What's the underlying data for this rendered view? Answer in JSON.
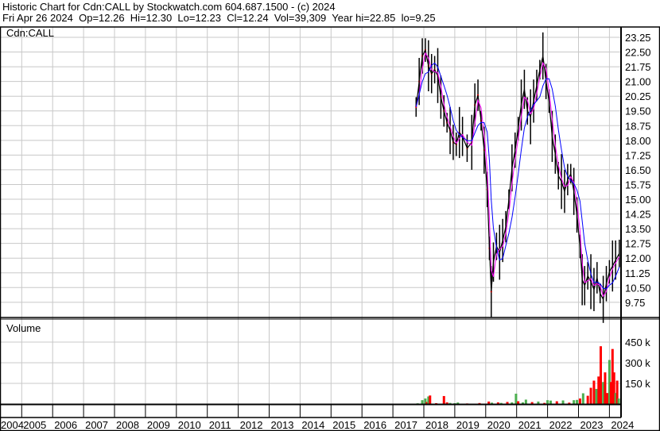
{
  "header": {
    "line1": "Historic Chart for Cdn:CALL by Stockwatch.com 604.687.1500 - (c) 2024",
    "line2": "Fri Apr 26 2024  Op=12.26  Hi=12.30  Lo=12.23  Cl=12.24  Vol=39,309  Year hi=22.85  lo=9.25"
  },
  "chart_data": {
    "type": "line",
    "symbol_label": "Cdn:CALL",
    "volume_label": "Volume",
    "x_tick_labels": [
      "2004",
      "2005",
      "2006",
      "2007",
      "2008",
      "2009",
      "2010",
      "2011",
      "2012",
      "2013",
      "2014",
      "2015",
      "2016",
      "2017",
      "2018",
      "2019",
      "2020",
      "2021",
      "2022",
      "2023",
      "2024"
    ],
    "y_ticks": [
      23.25,
      22.5,
      21.75,
      21.0,
      20.25,
      19.5,
      18.75,
      18.0,
      17.25,
      16.5,
      15.75,
      15.0,
      14.25,
      13.5,
      12.75,
      12.0,
      11.25,
      10.5,
      9.75
    ],
    "ylim": [
      9.25,
      23.8
    ],
    "volume_ticks": [
      {
        "value": 450,
        "label": "450 k"
      },
      {
        "value": 300,
        "label": "300 k"
      },
      {
        "value": 150,
        "label": "150 k"
      }
    ],
    "colors": {
      "price": "#000000",
      "down": "#ff0000",
      "up": "#4caf50",
      "ma_short": "#ff00ff",
      "ma_long": "#0000ff",
      "grid": "#c8c8c8"
    },
    "price": [
      [
        2017.75,
        19.7
      ],
      [
        2017.85,
        21.0
      ],
      [
        2017.95,
        22.3
      ],
      [
        2018.05,
        22.6
      ],
      [
        2018.15,
        21.8
      ],
      [
        2018.25,
        21.4
      ],
      [
        2018.35,
        21.6
      ],
      [
        2018.45,
        21.3
      ],
      [
        2018.55,
        20.2
      ],
      [
        2018.65,
        19.5
      ],
      [
        2018.75,
        18.9
      ],
      [
        2018.85,
        18.5
      ],
      [
        2018.95,
        17.9
      ],
      [
        2019.05,
        17.8
      ],
      [
        2019.15,
        18.4
      ],
      [
        2019.25,
        18.2
      ],
      [
        2019.4,
        17.6
      ],
      [
        2019.55,
        17.9
      ],
      [
        2019.65,
        19.8
      ],
      [
        2019.75,
        20.3
      ],
      [
        2019.85,
        19.0
      ],
      [
        2019.95,
        17.5
      ],
      [
        2020.05,
        15.5
      ],
      [
        2020.12,
        12.5
      ],
      [
        2020.18,
        10.3
      ],
      [
        2020.25,
        11.8
      ],
      [
        2020.35,
        12.6
      ],
      [
        2020.45,
        12.3
      ],
      [
        2020.55,
        12.9
      ],
      [
        2020.65,
        13.6
      ],
      [
        2020.75,
        15.0
      ],
      [
        2020.85,
        16.6
      ],
      [
        2020.95,
        17.5
      ],
      [
        2021.05,
        18.6
      ],
      [
        2021.15,
        19.8
      ],
      [
        2021.25,
        20.6
      ],
      [
        2021.35,
        19.5
      ],
      [
        2021.45,
        19.2
      ],
      [
        2021.55,
        20.0
      ],
      [
        2021.65,
        20.8
      ],
      [
        2021.75,
        21.6
      ],
      [
        2021.85,
        22.3
      ],
      [
        2021.95,
        21.0
      ],
      [
        2022.05,
        20.0
      ],
      [
        2022.15,
        18.2
      ],
      [
        2022.25,
        17.3
      ],
      [
        2022.35,
        16.2
      ],
      [
        2022.45,
        15.9
      ],
      [
        2022.55,
        15.4
      ],
      [
        2022.65,
        16.0
      ],
      [
        2022.75,
        16.3
      ],
      [
        2022.85,
        15.4
      ],
      [
        2022.95,
        14.2
      ],
      [
        2023.05,
        12.6
      ],
      [
        2023.12,
        10.9
      ],
      [
        2023.2,
        10.6
      ],
      [
        2023.3,
        11.1
      ],
      [
        2023.4,
        10.8
      ],
      [
        2023.5,
        10.4
      ],
      [
        2023.6,
        11.0
      ],
      [
        2023.7,
        10.2
      ],
      [
        2023.8,
        9.9
      ],
      [
        2023.9,
        10.7
      ],
      [
        2024.0,
        11.3
      ],
      [
        2024.1,
        11.6
      ],
      [
        2024.2,
        11.9
      ],
      [
        2024.32,
        12.24
      ]
    ],
    "volume_k": [
      [
        2017.8,
        5,
        "up"
      ],
      [
        2017.95,
        28,
        "up"
      ],
      [
        2018.05,
        40,
        "up"
      ],
      [
        2018.1,
        15,
        "down"
      ],
      [
        2018.15,
        55,
        "up"
      ],
      [
        2018.2,
        62,
        "down"
      ],
      [
        2018.4,
        6,
        "down"
      ],
      [
        2018.65,
        58,
        "down"
      ],
      [
        2018.75,
        12,
        "down"
      ],
      [
        2018.85,
        8,
        "up"
      ],
      [
        2019.0,
        6,
        "up"
      ],
      [
        2019.1,
        11,
        "up"
      ],
      [
        2019.4,
        4,
        "down"
      ],
      [
        2019.8,
        7,
        "down"
      ],
      [
        2020.1,
        18,
        "down"
      ],
      [
        2020.2,
        10,
        "up"
      ],
      [
        2020.4,
        12,
        "down"
      ],
      [
        2020.5,
        8,
        "up"
      ],
      [
        2020.7,
        15,
        "down"
      ],
      [
        2020.85,
        12,
        "up"
      ],
      [
        2020.98,
        75,
        "up"
      ],
      [
        2021.05,
        20,
        "down"
      ],
      [
        2021.2,
        12,
        "up"
      ],
      [
        2021.3,
        32,
        "up"
      ],
      [
        2021.5,
        14,
        "down"
      ],
      [
        2021.7,
        18,
        "up"
      ],
      [
        2021.9,
        8,
        "down"
      ],
      [
        2022.0,
        28,
        "up"
      ],
      [
        2022.1,
        25,
        "up"
      ],
      [
        2022.3,
        20,
        "down"
      ],
      [
        2022.5,
        26,
        "up"
      ],
      [
        2022.7,
        10,
        "down"
      ],
      [
        2022.85,
        28,
        "up"
      ],
      [
        2022.95,
        30,
        "up"
      ],
      [
        2023.05,
        40,
        "down"
      ],
      [
        2023.15,
        78,
        "up"
      ],
      [
        2023.3,
        60,
        "down"
      ],
      [
        2023.4,
        118,
        "down"
      ],
      [
        2023.5,
        170,
        "down"
      ],
      [
        2023.58,
        110,
        "up"
      ],
      [
        2023.65,
        200,
        "down"
      ],
      [
        2023.72,
        420,
        "down"
      ],
      [
        2023.8,
        160,
        "up"
      ],
      [
        2023.86,
        230,
        "down"
      ],
      [
        2023.93,
        80,
        "down"
      ],
      [
        2024.0,
        320,
        "up"
      ],
      [
        2024.05,
        160,
        "down"
      ],
      [
        2024.1,
        400,
        "down"
      ],
      [
        2024.15,
        230,
        "down"
      ],
      [
        2024.2,
        80,
        "up"
      ],
      [
        2024.25,
        170,
        "down"
      ],
      [
        2024.3,
        40,
        "up"
      ]
    ]
  }
}
